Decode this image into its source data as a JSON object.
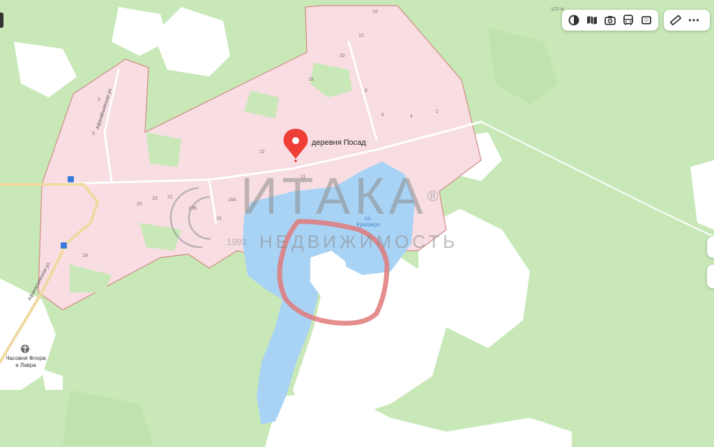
{
  "map": {
    "settlement_label": "деревня Посад",
    "lake_label_line1": "оз.",
    "lake_label_line2": "Кукозеро",
    "chapel_label_line1": "Часовня Флора",
    "chapel_label_line2": "и Лавра",
    "streets": [
      {
        "name": "Афанасьевская ул."
      },
      {
        "name": "Афанасьевская ул."
      }
    ],
    "house_numbers": [
      "16",
      "10",
      "20",
      "18",
      "8",
      "6",
      "4",
      "2",
      "9",
      "7",
      "5",
      "22",
      "11",
      "25",
      "23",
      "21",
      "19Б",
      "18А",
      "15",
      "2А"
    ],
    "scale_fragment": "123 м",
    "colors": {
      "settlement_fill": "#f8dde3",
      "settlement_border": "#d08a80",
      "water": "#a9d3f5",
      "forest": "#c8e8b8",
      "field": "#ffffff",
      "highlight_circle": "#e07a7a",
      "marker": "#ef3e36"
    }
  },
  "watermark": {
    "brand": "ИТАКА",
    "registered": "®",
    "subtitle": "НЕДВИЖИМОСТЬ",
    "year": "1993"
  },
  "toolbar": {
    "icons": [
      "layers-icon",
      "map-book-icon",
      "camera-icon",
      "bus-icon",
      "panorama-icon"
    ],
    "tools": [
      "ruler-icon",
      "more-icon"
    ]
  }
}
